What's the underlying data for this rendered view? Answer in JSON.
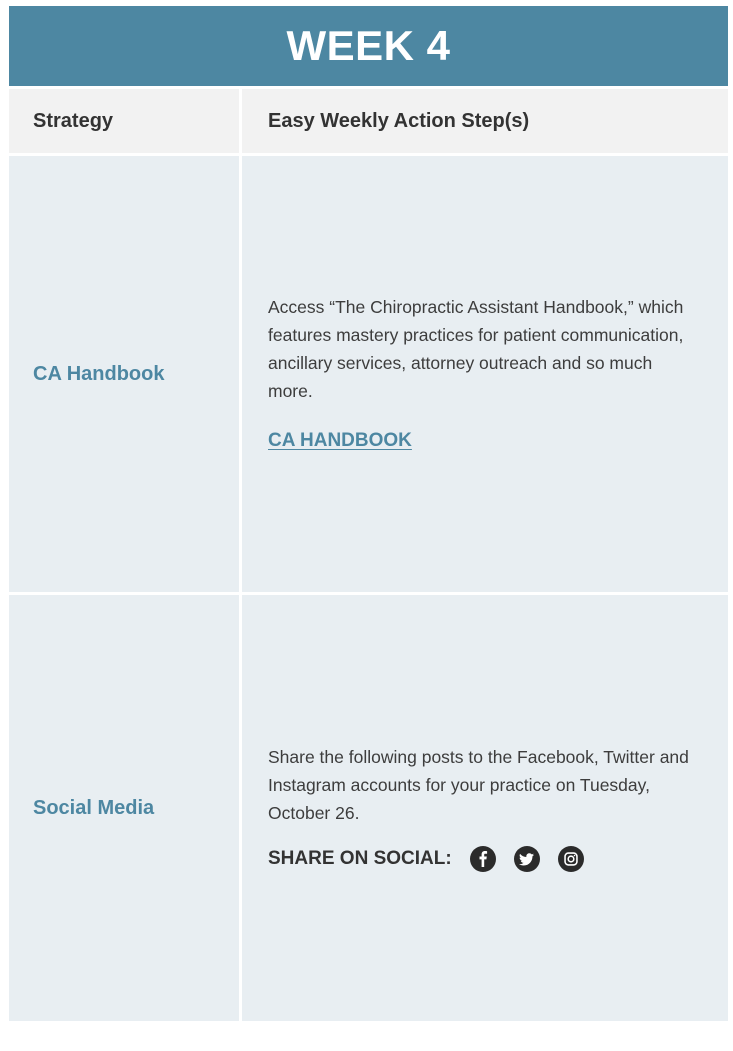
{
  "header": {
    "title": "WEEK 4"
  },
  "table": {
    "columns": [
      "Strategy",
      "Easy Weekly Action Step(s)"
    ],
    "rows": [
      {
        "strategy": "CA Handbook",
        "text": "Access “The Chiropractic Assistant Handbook,” which features mastery practices for patient communication, ancillary services, attorney outreach and so much more.",
        "link": "CA HANDBOOK"
      },
      {
        "strategy": "Social Media",
        "text": "Share the following posts to the Facebook, Twitter and Instagram accounts for your practice on Tuesday, October 26.",
        "social_label": "SHARE ON SOCIAL:",
        "icons": [
          "facebook-icon",
          "twitter-icon",
          "instagram-icon"
        ]
      }
    ]
  },
  "colors": {
    "accent": "#4d87a2",
    "header_row_bg": "#f2f2f2",
    "body_row_bg": "#e8eef2",
    "icon_bg": "#2b2b2b"
  }
}
